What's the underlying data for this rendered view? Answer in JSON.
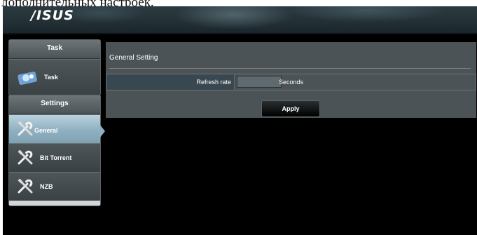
{
  "caption": "дополнительных настроек.",
  "brand": "/ISUS",
  "sidebar": {
    "task_header": "Task",
    "task_items": [
      {
        "label": "Task",
        "icon": "task-globe-icon"
      }
    ],
    "settings_header": "Settings",
    "settings_items": [
      {
        "label": "General",
        "icon": "tools-icon",
        "active": true
      },
      {
        "label": "Bit Torrent",
        "icon": "tools-icon",
        "active": false
      },
      {
        "label": "NZB",
        "icon": "tools-icon",
        "active": false
      }
    ]
  },
  "main": {
    "title": "General Setting",
    "refresh_label": "Refresh rate",
    "refresh_value": "",
    "refresh_unit": "Seconds",
    "apply_label": "Apply"
  },
  "colors": {
    "active_item": "#8fb0c0",
    "panel_bg": "#4b5357",
    "background": "#000000"
  }
}
